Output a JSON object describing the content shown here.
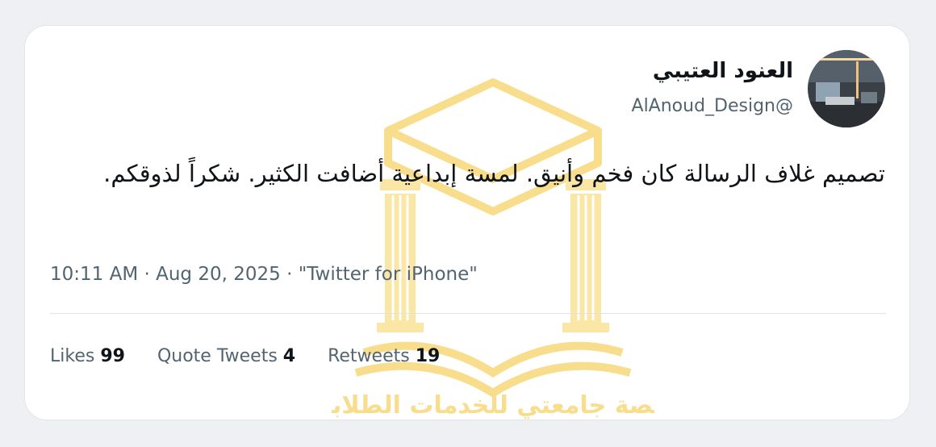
{
  "tweet": {
    "author": {
      "display_name": "العنود العتيبي",
      "handle": "@AlAnoud_Design"
    },
    "text": "تصميم غلاف الرسالة كان فخم وأنيق. لمسة إبداعية أضافت الكثير. شكراً لذوقكم.",
    "meta": {
      "time": "10:11 AM",
      "date": "Aug 20, 2025",
      "source": "\"Twitter for iPhone\"",
      "separator": " · "
    },
    "stats": {
      "likes_label": "Likes",
      "likes": "99",
      "quotes_label": "Quote Tweets",
      "quotes": "4",
      "retweets_label": "Retweets",
      "retweets": "19"
    }
  },
  "watermark": {
    "text": "منصة جامعتي للخدمات الطلابية",
    "color": "#f2c230"
  },
  "colors": {
    "text_primary": "#0f1419",
    "text_secondary": "#536471",
    "card_bg": "#ffffff",
    "page_bg": "#eef0f4"
  }
}
